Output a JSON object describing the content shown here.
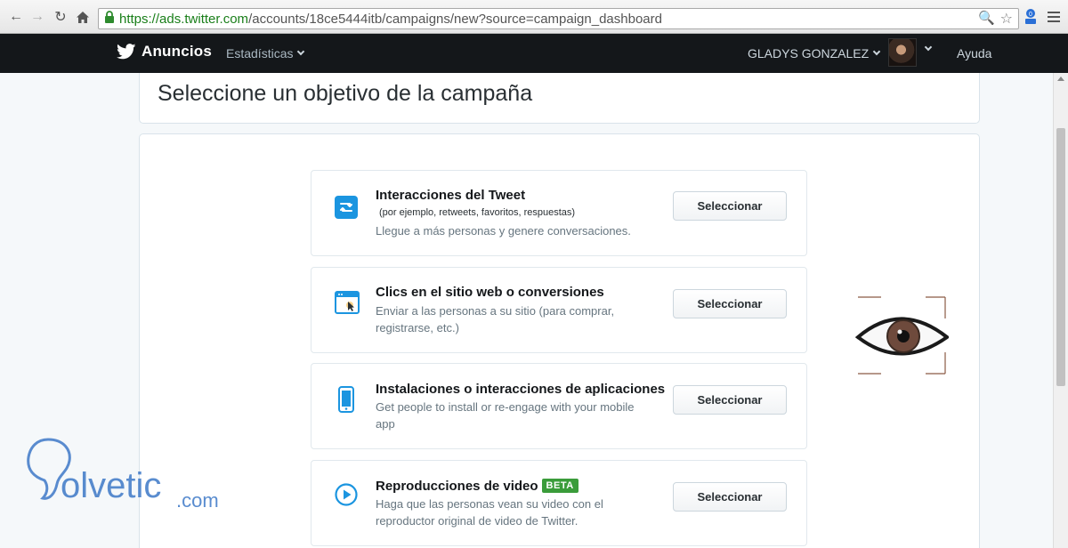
{
  "browser": {
    "url_host": "https://ads.twitter.com",
    "url_path": "/accounts/18ce5444itb/campaigns/new?source=campaign_dashboard"
  },
  "topbar": {
    "brand": "Anuncios",
    "stats_menu": "Estadísticas",
    "user_name": "GLADYS GONZALEZ",
    "help": "Ayuda"
  },
  "page": {
    "title": "Seleccione un objetivo de la campaña"
  },
  "objectives": [
    {
      "title": "Interacciones del Tweet",
      "subtitle": "(por ejemplo, retweets, favoritos, respuestas)",
      "description": "Llegue a más personas y genere conversaciones.",
      "button": "Seleccionar",
      "icon": "retweet-icon"
    },
    {
      "title": "Clics en el sitio web o conversiones",
      "description": "Enviar a las personas a su sitio (para comprar, registrarse, etc.)",
      "button": "Seleccionar",
      "icon": "website-click-icon"
    },
    {
      "title": "Instalaciones o interacciones de aplicaciones",
      "description": "Get people to install or re-engage with your mobile app",
      "button": "Seleccionar",
      "icon": "mobile-icon"
    },
    {
      "title": "Reproducciones de video",
      "badge": "BETA",
      "description": "Haga que las personas vean su video con el reproductor original de video de Twitter.",
      "button": "Seleccionar",
      "icon": "play-icon"
    }
  ],
  "watermark": {
    "brand": "olvetic",
    "suffix": ".com"
  },
  "colors": {
    "twitter_blue": "#1b95e0",
    "topbar": "#14171a",
    "beta_green": "#3a9c3a",
    "url_green": "#1a7f1a"
  }
}
